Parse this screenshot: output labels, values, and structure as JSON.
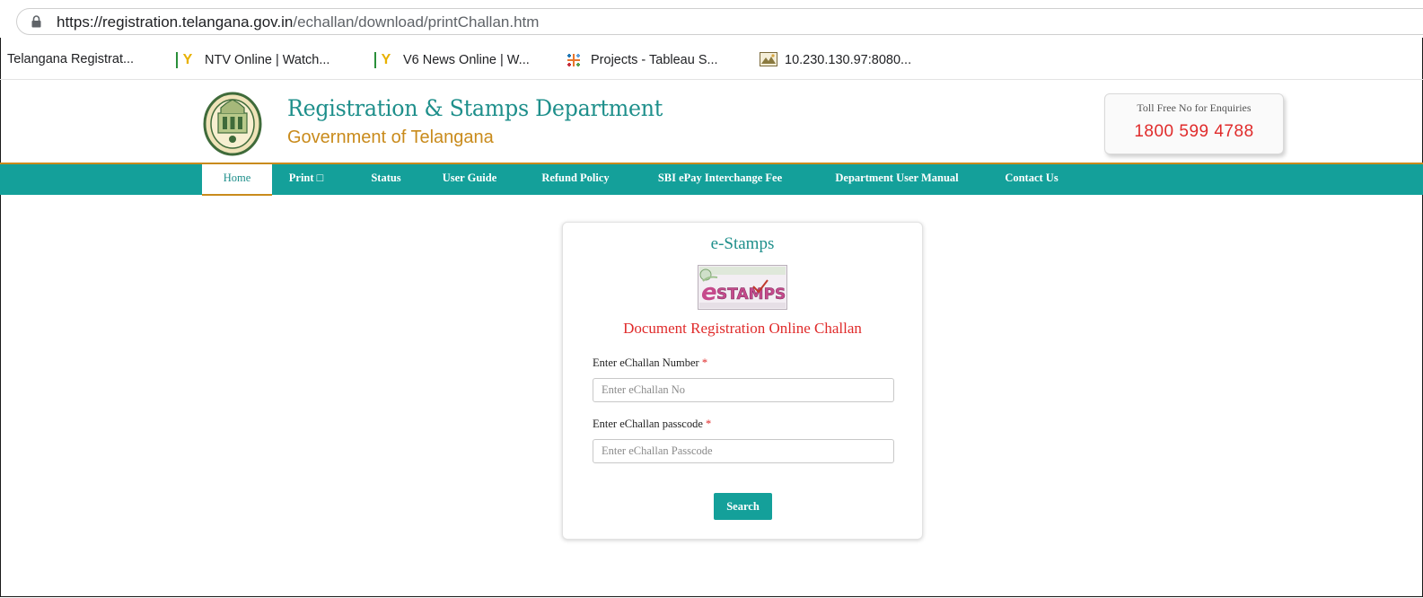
{
  "browser": {
    "url_host": "https://registration.telangana.gov.in",
    "url_path": "/echallan/download/printChallan.htm",
    "bookmarks": [
      {
        "label": "Telangana Registrat...",
        "icon": "none"
      },
      {
        "label": "NTV Online | Watch...",
        "icon": "y-logo-icon"
      },
      {
        "label": "V6 News Online | W...",
        "icon": "y-logo-icon"
      },
      {
        "label": "Projects - Tableau S...",
        "icon": "tableau-icon"
      },
      {
        "label": "10.230.130.97:8080...",
        "icon": "image-thumbnail-icon"
      }
    ]
  },
  "header": {
    "title": "Registration & Stamps Department",
    "subtitle": "Government of Telangana",
    "toll_label": "Toll Free No for Enquiries",
    "toll_number": "1800 599 4788"
  },
  "nav": {
    "items": [
      {
        "label": "Home"
      },
      {
        "label": "Print □"
      },
      {
        "label": "Status"
      },
      {
        "label": "User Guide"
      },
      {
        "label": "Refund Policy"
      },
      {
        "label": "SBI ePay Interchange Fee"
      },
      {
        "label": "Department User Manual"
      },
      {
        "label": "Contact Us"
      }
    ]
  },
  "form": {
    "title": "e-Stamps",
    "subtitle": "Document Registration Online Challan",
    "fields": [
      {
        "label": "Enter eChallan Number",
        "required_mark": "*",
        "placeholder": "Enter eChallan No",
        "value": ""
      },
      {
        "label": "Enter eChallan passcode",
        "required_mark": "*",
        "placeholder": "Enter eChallan Passcode",
        "value": ""
      }
    ],
    "submit_label": "Search"
  },
  "colors": {
    "teal": "#14a09a",
    "gold": "#c98b1c",
    "red": "#e02b2b"
  }
}
